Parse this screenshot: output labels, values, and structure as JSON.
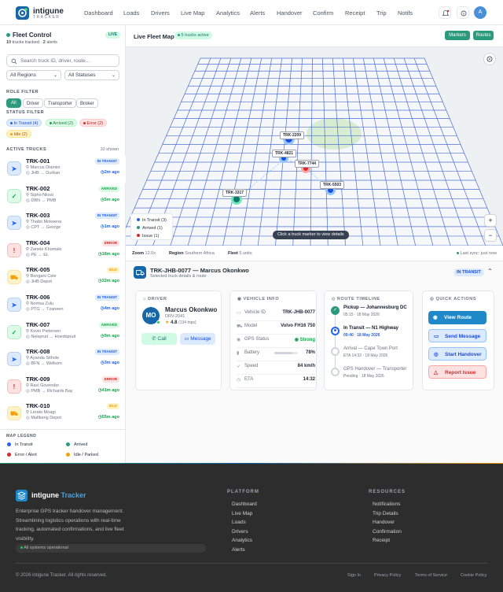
{
  "header": {
    "brand_name": "intigune",
    "brand_sub": "TRACKER",
    "nav": [
      "Dashboard",
      "Loads",
      "Drivers",
      "Live Map",
      "Analytics",
      "Alerts",
      "Handover",
      "Confirm",
      "Receipt",
      "Trip",
      "Notifs"
    ],
    "avatar": "A"
  },
  "sidebar": {
    "title": "Fleet Control",
    "live_badge": "LIVE",
    "trucks_tracked": "10",
    "trucks_tracked_label": "trucks tracked",
    "alerts_count": "2",
    "alerts_label": "alerts",
    "search_placeholder": "Search truck ID, driver, route...",
    "region_select": "All Regions",
    "status_select": "All Statuses",
    "role_filter_title": "ROLE FILTER",
    "roles": [
      "All",
      "Driver",
      "Transporter",
      "Broker"
    ],
    "status_filter_title": "STATUS FILTER",
    "status_chips": [
      "In Transit (4)",
      "Arrived (2)",
      "Error (2)",
      "Idle (2)"
    ],
    "active_trucks_title": "ACTIVE TRUCKS",
    "shown": "10 shown",
    "trucks": [
      {
        "id": "TRK-001",
        "driver": "Marcus Dlamini",
        "route": "JHB → Durban",
        "status": "IN TRANSIT",
        "time": "2m ago",
        "kind": "transit"
      },
      {
        "id": "TRK-002",
        "driver": "Sipho Nkosi",
        "route": "DBN → PMB",
        "status": "ARRIVED",
        "time": "5m ago",
        "kind": "arrived"
      },
      {
        "id": "TRK-003",
        "driver": "Thabo Mokoena",
        "route": "CPT → George",
        "status": "IN TRANSIT",
        "time": "1m ago",
        "kind": "transit"
      },
      {
        "id": "TRK-004",
        "driver": "Zanele Khumalo",
        "route": "PE → EL",
        "status": "ERROR",
        "time": "18m ago",
        "kind": "error"
      },
      {
        "id": "TRK-005",
        "driver": "Bongani Cele",
        "route": "JHB Depot",
        "status": "IDLE",
        "time": "32m ago",
        "kind": "idle"
      },
      {
        "id": "TRK-006",
        "driver": "Nomsa Zulu",
        "route": "PTG → Tzaneen",
        "status": "IN TRANSIT",
        "time": "4m ago",
        "kind": "transit"
      },
      {
        "id": "TRK-007",
        "driver": "Kevin Pietersen",
        "route": "Nelspruit → Hoedspruit",
        "status": "ARRIVED",
        "time": "9m ago",
        "kind": "arrived"
      },
      {
        "id": "TRK-008",
        "driver": "Ayanda Sithole",
        "route": "BFN → Welkom",
        "status": "IN TRANSIT",
        "time": "3m ago",
        "kind": "transit"
      },
      {
        "id": "TRK-009",
        "driver": "Ravi Govender",
        "route": "PMB → Richards Bay",
        "status": "ERROR",
        "time": "41m ago",
        "kind": "error"
      },
      {
        "id": "TRK-010",
        "driver": "Lerato Moagi",
        "route": "Mafikeng Depot",
        "status": "IDLE",
        "time": "55m ago",
        "kind": "idle"
      }
    ],
    "legend_title": "MAP LEGEND",
    "legend": [
      "In Transit",
      "Arrived",
      "Error / Alert",
      "Idle / Parked"
    ]
  },
  "map": {
    "title": "Live Fleet Map",
    "active_badge": "5 trucks active",
    "markers_btn": "Markers",
    "routes_btn": "Routes",
    "trucks": [
      "TRK-2209",
      "TRK-4821",
      "TRK-7744",
      "TRK-5503",
      "TRK-3317"
    ],
    "legend": [
      "In Transit (3)",
      "Arrived (1)",
      "Issue (1)"
    ],
    "hint": "Click a truck marker to view details",
    "zoom_in": "+",
    "zoom_out": "−",
    "zoom_label": "Zoom",
    "zoom_value": "12.0x",
    "region_label": "Region",
    "region_value": "Southern Africa",
    "fleet_label": "Fleet",
    "fleet_value": "5 units",
    "sync": "Last sync: just now"
  },
  "detail": {
    "title": "TRK-JHB-0077 — Marcus Okonkwo",
    "subtitle": "Selected truck details & route",
    "status": "IN TRANSIT",
    "driver_title": "DRIVER",
    "driver_initials": "MO",
    "driver_name": "Marcus Okonkwo",
    "driver_id": "DRV-2041",
    "rating": "4.8",
    "trips": "(134 trips)",
    "call_btn": "Call",
    "message_btn": "Message",
    "vehicle_title": "VEHICLE INFO",
    "vehicle_rows": [
      {
        "label": "Vehicle ID",
        "value": "TRK-JHB-0077"
      },
      {
        "label": "Model",
        "value": "Volvo FH16 750"
      },
      {
        "label": "GPS Status",
        "value": "Strong"
      },
      {
        "label": "Battery",
        "value": "78%"
      },
      {
        "label": "Speed",
        "value": "84 km/h"
      },
      {
        "label": "ETA",
        "value": "14:32"
      }
    ],
    "battery_level": 0.78,
    "timeline_title": "ROUTE TIMELINE",
    "timeline": [
      {
        "title": "Pickup — Johannesburg DC",
        "sub": "05:15 · 18 May 2026"
      },
      {
        "title": "In Transit — N1 Highway",
        "sub": "09:40 · 18 May 2026"
      },
      {
        "title": "Arrival — Cape Town Port",
        "sub": "ETA 14:32 · 18 May 2026"
      },
      {
        "title": "GPS Handover — Transporter",
        "sub": "Pending · 18 May 2026"
      }
    ],
    "qa_title": "QUICK ACTIONS",
    "actions": [
      "View Route",
      "Send Message",
      "Start Handover",
      "Report Issue"
    ]
  },
  "footer": {
    "brand": "intigune",
    "brand_accent": "Tracker",
    "desc": [
      "Enterprise GPS tracker handover management.",
      "Streamlining logistics operations with real-time",
      "tracking, automated confirmations, and live fleet",
      "visibility."
    ],
    "status": "All systems operational",
    "platform_title": "PLATFORM",
    "platform": [
      "Dashboard",
      "Live Map",
      "Loads",
      "Drivers",
      "Analytics",
      "Alerts"
    ],
    "resources_title": "RESOURCES",
    "resources": [
      "Notifications",
      "Trip Details",
      "Handover",
      "Confirmation",
      "Receipt"
    ],
    "copyright": "© 2026 intigune Tracker. All rights reserved.",
    "legal": [
      "Sign In",
      "Privacy Policy",
      "Terms of Service",
      "Cookie Policy"
    ]
  },
  "colors": {
    "primary": "#1766a8",
    "teal": "#2b9a7d",
    "transit": "#2563eb",
    "arrived": "#16a34a",
    "error": "#dc2626",
    "idle": "#f59e0b"
  }
}
